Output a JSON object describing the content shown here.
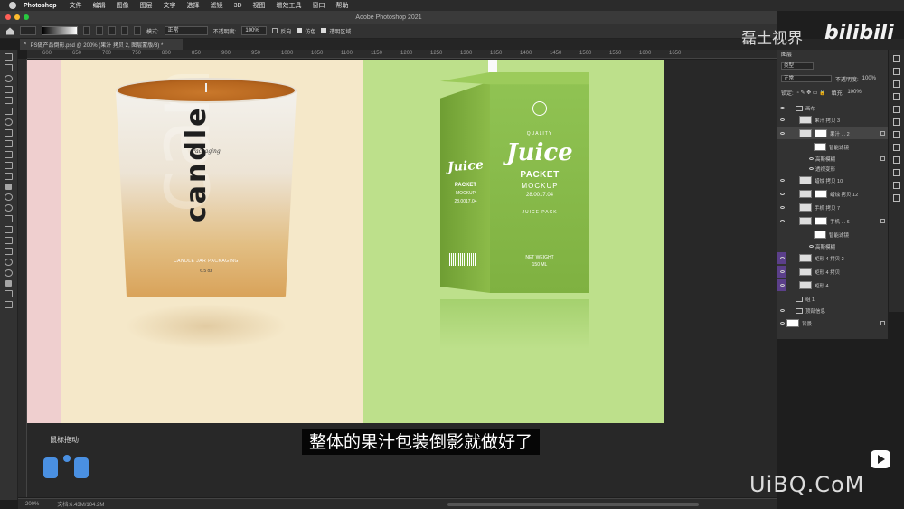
{
  "menubar": {
    "app": "Photoshop",
    "items": [
      "文件",
      "编辑",
      "图像",
      "图层",
      "文字",
      "选择",
      "滤镜",
      "3D",
      "视图",
      "增效工具",
      "窗口",
      "帮助"
    ]
  },
  "window": {
    "title": "Adobe Photoshop 2021"
  },
  "options": {
    "mode_label": "模式:",
    "mode_value": "正常",
    "opacity_label": "不透明度:",
    "opacity_value": "100%",
    "reverse_label": "反向",
    "dither_label": "仿色",
    "transparency_label": "透明区域"
  },
  "document_tab": {
    "title": "PS做产品倒影.psd @ 200% (果汁 拷贝 2, 图层蒙版/8) *"
  },
  "ruler": {
    "ticks": [
      "600",
      "650",
      "700",
      "750",
      "800",
      "850",
      "900",
      "950",
      "1000",
      "1050",
      "1100",
      "1150",
      "1200",
      "1250",
      "1300",
      "1350",
      "1400",
      "1450",
      "1500",
      "1550",
      "1600",
      "1650"
    ]
  },
  "candle": {
    "brand": "Packaging",
    "word": "candle",
    "ghost": "can",
    "sub": "CANDLE JAR PACKAGING",
    "oz": "6.5 oz"
  },
  "juice": {
    "quality": "QUALITY",
    "title": "Juice",
    "packet": "PACKET",
    "mockup": "MOCKUP",
    "date": "28.0017.04",
    "pack": "JUICE PACK",
    "weight": "NET WEIGHT",
    "ml": "150 ML",
    "side_title": "Juice",
    "side_packet": "PACKET",
    "side_mockup": "MOCKUP",
    "side_date": "28.0017.04"
  },
  "subtitle": "整体的果汁包装倒影就做好了",
  "hint": "鼠标拖动",
  "status": {
    "zoom": "200%",
    "doc_size": "文档:6.43M/104.2M"
  },
  "watermark": {
    "channel": "磊土视界",
    "bili": "bilibili",
    "site": "UiBQ.CoM"
  },
  "layers_panel": {
    "title": "图层",
    "filter_label": "类型",
    "blend_mode": "正常",
    "opacity_label": "不透明度:",
    "opacity_value": "100%",
    "lock_label": "锁定:",
    "fill_label": "填充:",
    "fill_value": "100%",
    "layers": [
      {
        "name": "画布",
        "kind": "folder",
        "visible": true
      },
      {
        "name": "果汁 拷贝 3",
        "kind": "layer",
        "visible": true
      },
      {
        "name": "果汁 ... 2",
        "kind": "masked",
        "visible": true,
        "selected": true
      },
      {
        "name": "智能滤镜",
        "kind": "filter",
        "visible": false
      },
      {
        "name": "高斯模糊",
        "kind": "sub",
        "visible": true
      },
      {
        "name": "透视变形",
        "kind": "sub",
        "visible": true
      },
      {
        "name": "蜡烛 拷贝 10",
        "kind": "layer",
        "visible": true
      },
      {
        "name": "蜡烛 拷贝 12",
        "kind": "masked",
        "visible": true
      },
      {
        "name": "手机 拷贝 7",
        "kind": "layer",
        "visible": true
      },
      {
        "name": "手机 ... 6",
        "kind": "masked",
        "visible": true
      },
      {
        "name": "智能滤镜",
        "kind": "filter",
        "visible": false
      },
      {
        "name": "高斯模糊",
        "kind": "sub",
        "visible": true
      },
      {
        "name": "矩形 4 拷贝 2",
        "kind": "layer",
        "visible": true,
        "purple": true
      },
      {
        "name": "矩形 4 拷贝",
        "kind": "layer",
        "visible": true,
        "purple": true
      },
      {
        "name": "矩形 4",
        "kind": "layer",
        "visible": true,
        "purple": true
      },
      {
        "name": "组 1",
        "kind": "folder",
        "visible": false
      },
      {
        "name": "顶部信息",
        "kind": "folder",
        "visible": true
      },
      {
        "name": "背景",
        "kind": "bg",
        "visible": true
      }
    ]
  }
}
